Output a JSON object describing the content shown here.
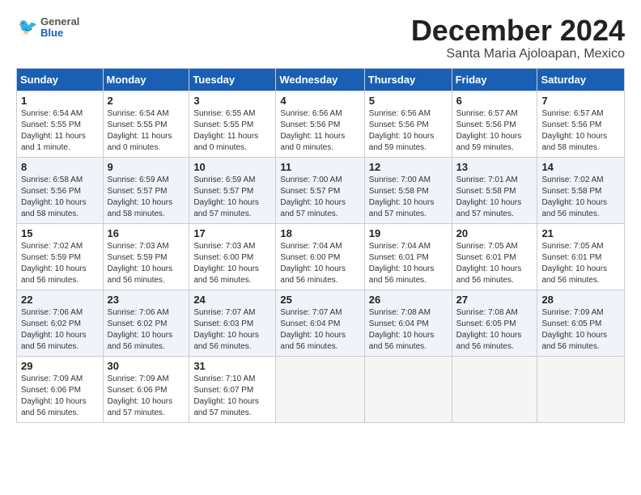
{
  "logo": {
    "general": "General",
    "blue": "Blue"
  },
  "title": "December 2024",
  "location": "Santa Maria Ajoloapan, Mexico",
  "days_of_week": [
    "Sunday",
    "Monday",
    "Tuesday",
    "Wednesday",
    "Thursday",
    "Friday",
    "Saturday"
  ],
  "weeks": [
    [
      {
        "day": "1",
        "info": "Sunrise: 6:54 AM\nSunset: 5:55 PM\nDaylight: 11 hours\nand 1 minute."
      },
      {
        "day": "2",
        "info": "Sunrise: 6:54 AM\nSunset: 5:55 PM\nDaylight: 11 hours\nand 0 minutes."
      },
      {
        "day": "3",
        "info": "Sunrise: 6:55 AM\nSunset: 5:55 PM\nDaylight: 11 hours\nand 0 minutes."
      },
      {
        "day": "4",
        "info": "Sunrise: 6:56 AM\nSunset: 5:56 PM\nDaylight: 11 hours\nand 0 minutes."
      },
      {
        "day": "5",
        "info": "Sunrise: 6:56 AM\nSunset: 5:56 PM\nDaylight: 10 hours\nand 59 minutes."
      },
      {
        "day": "6",
        "info": "Sunrise: 6:57 AM\nSunset: 5:56 PM\nDaylight: 10 hours\nand 59 minutes."
      },
      {
        "day": "7",
        "info": "Sunrise: 6:57 AM\nSunset: 5:56 PM\nDaylight: 10 hours\nand 58 minutes."
      }
    ],
    [
      {
        "day": "8",
        "info": "Sunrise: 6:58 AM\nSunset: 5:56 PM\nDaylight: 10 hours\nand 58 minutes."
      },
      {
        "day": "9",
        "info": "Sunrise: 6:59 AM\nSunset: 5:57 PM\nDaylight: 10 hours\nand 58 minutes."
      },
      {
        "day": "10",
        "info": "Sunrise: 6:59 AM\nSunset: 5:57 PM\nDaylight: 10 hours\nand 57 minutes."
      },
      {
        "day": "11",
        "info": "Sunrise: 7:00 AM\nSunset: 5:57 PM\nDaylight: 10 hours\nand 57 minutes."
      },
      {
        "day": "12",
        "info": "Sunrise: 7:00 AM\nSunset: 5:58 PM\nDaylight: 10 hours\nand 57 minutes."
      },
      {
        "day": "13",
        "info": "Sunrise: 7:01 AM\nSunset: 5:58 PM\nDaylight: 10 hours\nand 57 minutes."
      },
      {
        "day": "14",
        "info": "Sunrise: 7:02 AM\nSunset: 5:58 PM\nDaylight: 10 hours\nand 56 minutes."
      }
    ],
    [
      {
        "day": "15",
        "info": "Sunrise: 7:02 AM\nSunset: 5:59 PM\nDaylight: 10 hours\nand 56 minutes."
      },
      {
        "day": "16",
        "info": "Sunrise: 7:03 AM\nSunset: 5:59 PM\nDaylight: 10 hours\nand 56 minutes."
      },
      {
        "day": "17",
        "info": "Sunrise: 7:03 AM\nSunset: 6:00 PM\nDaylight: 10 hours\nand 56 minutes."
      },
      {
        "day": "18",
        "info": "Sunrise: 7:04 AM\nSunset: 6:00 PM\nDaylight: 10 hours\nand 56 minutes."
      },
      {
        "day": "19",
        "info": "Sunrise: 7:04 AM\nSunset: 6:01 PM\nDaylight: 10 hours\nand 56 minutes."
      },
      {
        "day": "20",
        "info": "Sunrise: 7:05 AM\nSunset: 6:01 PM\nDaylight: 10 hours\nand 56 minutes."
      },
      {
        "day": "21",
        "info": "Sunrise: 7:05 AM\nSunset: 6:01 PM\nDaylight: 10 hours\nand 56 minutes."
      }
    ],
    [
      {
        "day": "22",
        "info": "Sunrise: 7:06 AM\nSunset: 6:02 PM\nDaylight: 10 hours\nand 56 minutes."
      },
      {
        "day": "23",
        "info": "Sunrise: 7:06 AM\nSunset: 6:02 PM\nDaylight: 10 hours\nand 56 minutes."
      },
      {
        "day": "24",
        "info": "Sunrise: 7:07 AM\nSunset: 6:03 PM\nDaylight: 10 hours\nand 56 minutes."
      },
      {
        "day": "25",
        "info": "Sunrise: 7:07 AM\nSunset: 6:04 PM\nDaylight: 10 hours\nand 56 minutes."
      },
      {
        "day": "26",
        "info": "Sunrise: 7:08 AM\nSunset: 6:04 PM\nDaylight: 10 hours\nand 56 minutes."
      },
      {
        "day": "27",
        "info": "Sunrise: 7:08 AM\nSunset: 6:05 PM\nDaylight: 10 hours\nand 56 minutes."
      },
      {
        "day": "28",
        "info": "Sunrise: 7:09 AM\nSunset: 6:05 PM\nDaylight: 10 hours\nand 56 minutes."
      }
    ],
    [
      {
        "day": "29",
        "info": "Sunrise: 7:09 AM\nSunset: 6:06 PM\nDaylight: 10 hours\nand 56 minutes."
      },
      {
        "day": "30",
        "info": "Sunrise: 7:09 AM\nSunset: 6:06 PM\nDaylight: 10 hours\nand 57 minutes."
      },
      {
        "day": "31",
        "info": "Sunrise: 7:10 AM\nSunset: 6:07 PM\nDaylight: 10 hours\nand 57 minutes."
      },
      null,
      null,
      null,
      null
    ]
  ]
}
